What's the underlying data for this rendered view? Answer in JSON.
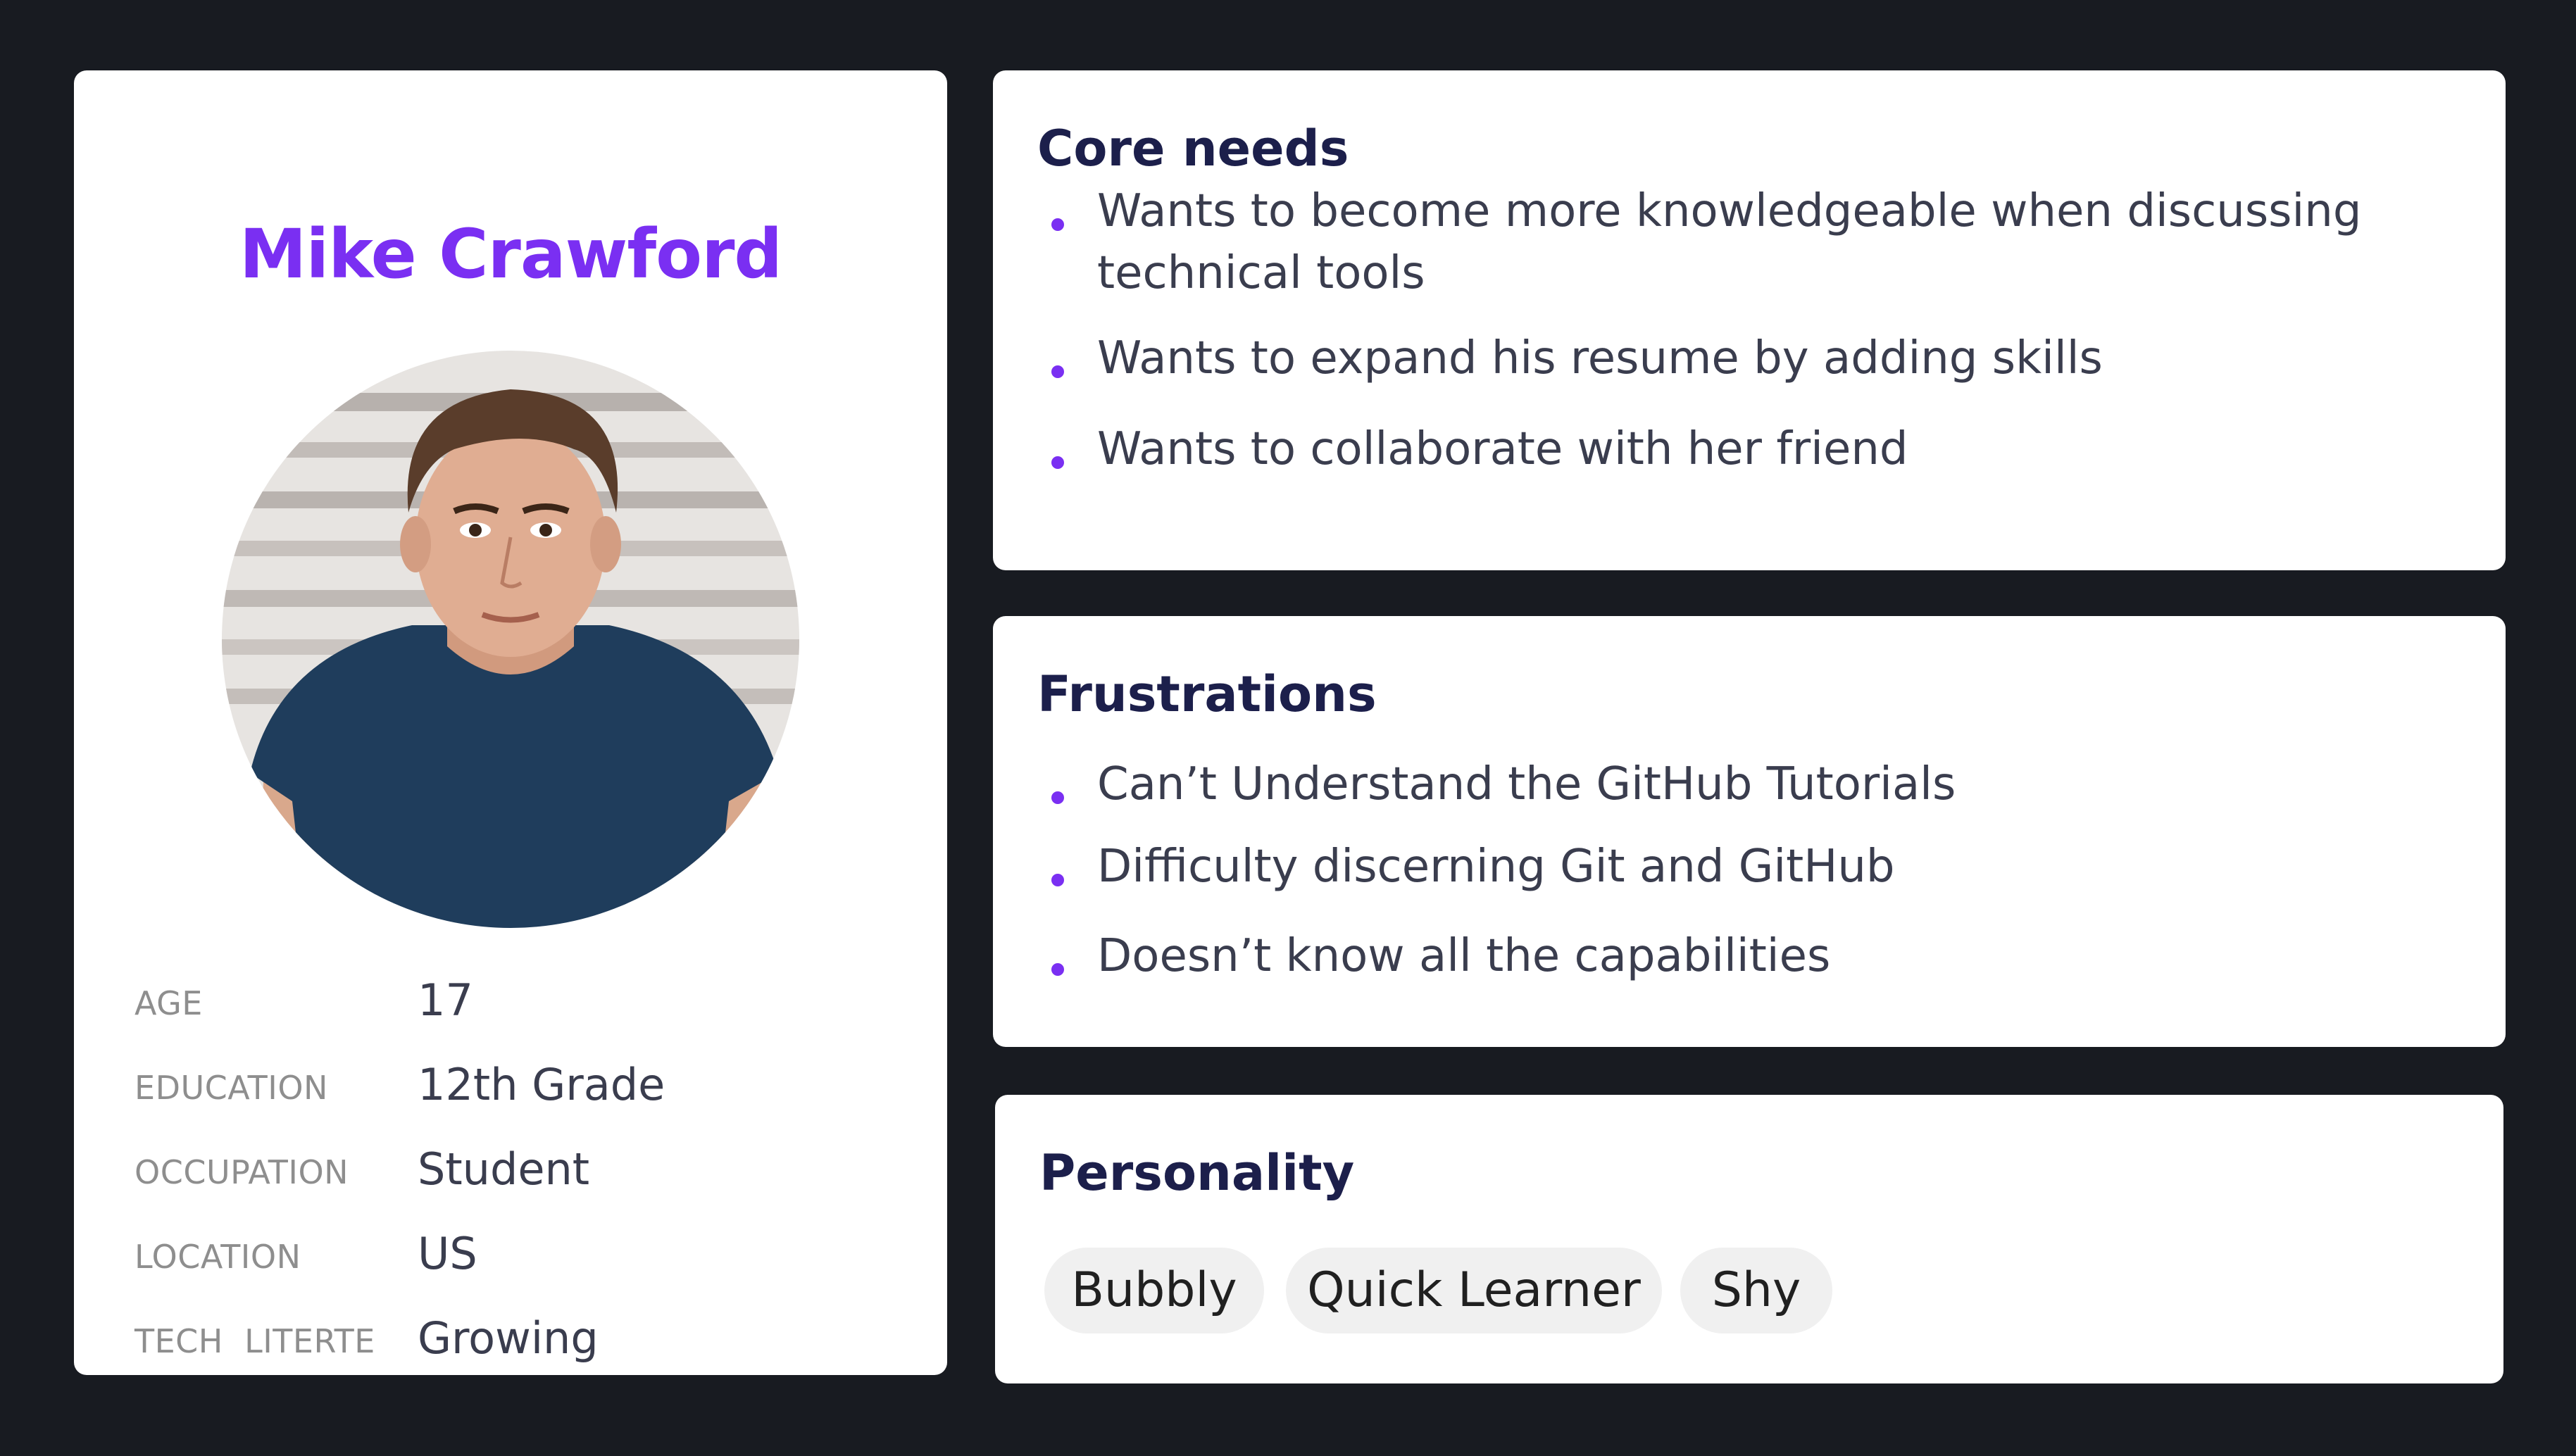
{
  "profile": {
    "name": "Mike Crawford",
    "attributes": [
      {
        "label": "AGE",
        "value": "17"
      },
      {
        "label": "EDUCATION",
        "value": "12th Grade"
      },
      {
        "label": "OCCUPATION",
        "value": "Student"
      },
      {
        "label": "LOCATION",
        "value": "US"
      },
      {
        "label": "TECH  LITERTE",
        "value": "Growing"
      }
    ]
  },
  "core_needs": {
    "title": "Core needs",
    "items": [
      "Wants to become more knowledgeable when discussing technical tools",
      "Wants to expand his resume by adding skills",
      "Wants to collaborate with her friend"
    ]
  },
  "frustrations": {
    "title": "Frustrations",
    "items": [
      "Can’t Understand the GitHub Tutorials",
      "Difficulty discerning Git and GitHub",
      "Doesn’t know all the capabilities"
    ]
  },
  "personality": {
    "title": "Personality",
    "traits": [
      "Bubbly",
      "Quick Learner",
      "Shy"
    ]
  },
  "colors": {
    "background": "#181b21",
    "accent": "#7a2ff2",
    "heading": "#1c1f4b",
    "body_text": "#3a3d4e",
    "label": "#8e8e8e",
    "chip": "#f0f0f0"
  }
}
